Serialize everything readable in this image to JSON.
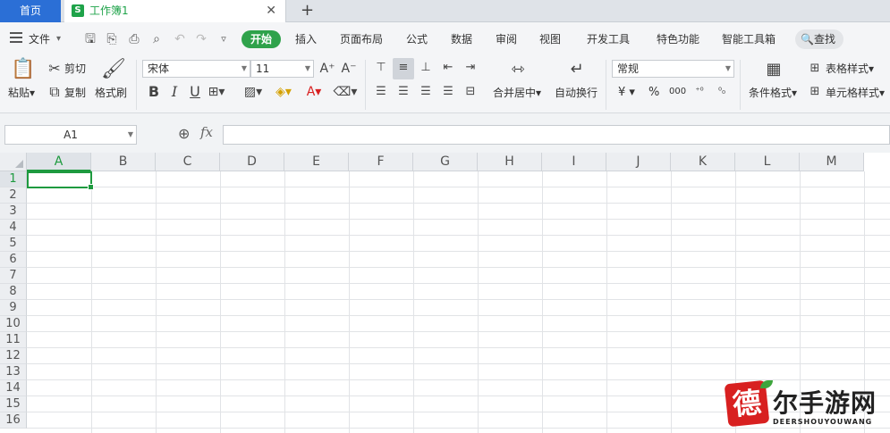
{
  "tabs": {
    "home": "首页",
    "doc_icon": "S",
    "doc_name": "工作簿1",
    "close": "✕",
    "add": "+"
  },
  "menu": {
    "file": "文件",
    "items": [
      "插入",
      "页面布局",
      "公式",
      "数据",
      "审阅",
      "视图",
      "开发工具",
      "特色功能",
      "智能工具箱"
    ],
    "start": "开始",
    "search": "查找"
  },
  "ribbon": {
    "paste": "粘贴",
    "cut": "剪切",
    "copy": "复制",
    "format_painter": "格式刷",
    "font_name": "宋体",
    "font_size": "11",
    "merge_center": "合并居中",
    "wrap_text": "自动换行",
    "number_format": "常规",
    "currency": "¥",
    "percent": "%",
    "thousands": "000",
    "cond_format": "条件格式",
    "table_style": "表格样式",
    "cell_style": "单元格样式"
  },
  "formula_bar": {
    "cell_ref": "A1",
    "fx": "fx",
    "value": ""
  },
  "sheet": {
    "columns": [
      "A",
      "B",
      "C",
      "D",
      "E",
      "F",
      "G",
      "H",
      "I",
      "J",
      "K",
      "L",
      "M"
    ],
    "rows": [
      "1",
      "2",
      "3",
      "4",
      "5",
      "6",
      "7",
      "8",
      "9",
      "10",
      "11",
      "12",
      "13",
      "14",
      "15",
      "16"
    ],
    "active_cell": "A1",
    "accent": "#1e9a3f"
  },
  "watermark": {
    "logo_char": "德",
    "text": "尔手游网",
    "sub": "DEERSHOUYOUWANG"
  }
}
